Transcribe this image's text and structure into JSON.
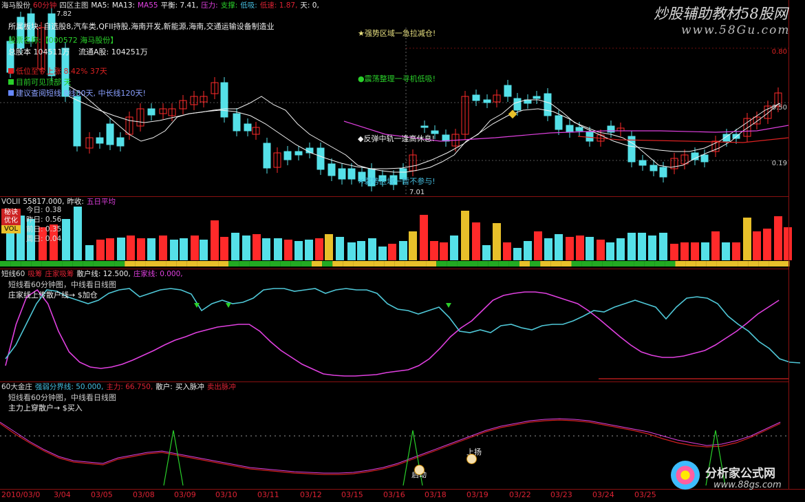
{
  "main": {
    "stock": "海马股份",
    "period": "60分钟",
    "chart_name": "四区主图",
    "ma5": "MA5:",
    "ma13": "MA13:",
    "ma55": "MA55",
    "balance": "平衡: 7.41,",
    "pressure": "压力:",
    "support": "支撑:",
    "absorb": "低吸:",
    "fall": "低速: 1.87,",
    "day": "天: 0,",
    "high_marker": "7.82",
    "low_marker": "7.01",
    "sector": "所属板块: 自选股8,汽车类,QFII持股,海南开发,新能源,海南,交通运输设备制造业",
    "name_label": "股票名称:",
    "name_value": "【000572 海马股份】",
    "total": "总股本 104511万",
    "float": "流通A股: 104251万",
    "row1": "低位至今上涨 8.42%  37天",
    "row2": "目前可见顶部 天",
    "row3": "建议查阅短线 8线30天, 中长线120天!",
    "zone1": "★强势区域一急拉减仓!",
    "zone2": "●震荡整理一寻机低吸!",
    "zone3": "◆反弹中轨一逢高休息!",
    "zone4": "✕弱势区域一暂不参与!",
    "y_labels": [
      "0.80",
      "0.50",
      "0.19"
    ]
  },
  "vol": {
    "title": "VOLII",
    "value": "55817.000,",
    "prev": "昨收:",
    "avg": "五日平均",
    "badges": [
      "秘诀",
      "优化",
      "VOL"
    ],
    "stats": [
      {
        "label": "今日",
        "value": "0.38"
      },
      {
        "label": "昨日",
        "value": "0.56"
      },
      {
        "label": "前日",
        "value": "0.35"
      },
      {
        "label": "周日",
        "value": "0.04"
      }
    ]
  },
  "short": {
    "title": "短线60",
    "v1": "吸筹",
    "v2": "庄家吸筹",
    "retail": "散户线: 12.500,",
    "banker": "庄家线: 0.000,",
    "note1": "短线看60分钟图，中线看日线图",
    "note2": "庄家线上传散户线→ $加仓"
  },
  "golden": {
    "title": "60大金庄",
    "divider": "强弱分界线: 50.000,",
    "main_force": "主力: 66.750,",
    "retail": "散户:",
    "buy": "买入脉冲",
    "sell": "卖出脉冲",
    "note1": "短线看60分钟图，中线看日线图",
    "note2": "主力上穿散户→ $买入",
    "label_up": "上扬",
    "label_start": "启动"
  },
  "dates": [
    "2010/03/0",
    "3/04",
    "03/05",
    "03/08",
    "03/09",
    "03/10",
    "03/11",
    "03/12",
    "03/15",
    "03/16",
    "03/18",
    "03/19",
    "03/22",
    "03/23",
    "03/24",
    "03/25"
  ],
  "watermark": {
    "top": "炒股辅助教材",
    "top_site": "58股网",
    "top_url": "www.58Gu.com",
    "bottom": "分析家公式网",
    "bottom_url": "www.88gs.com"
  },
  "colors": {
    "up": "#ff2a2a",
    "down": "#55e0e8",
    "yellow": "#e8c02a",
    "magenta": "#e040e0",
    "red": "#d22020"
  }
}
